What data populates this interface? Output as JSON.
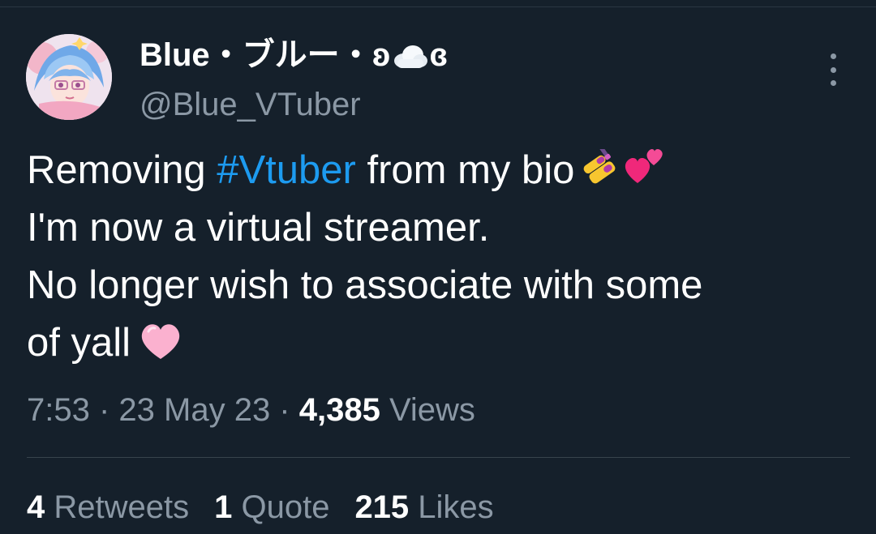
{
  "author": {
    "display_name_prefix": "Blue・ブルー・ʚ",
    "display_name_suffix": "ɞ",
    "handle": "@Blue_VTuber"
  },
  "tweet": {
    "line1_before": "Removing ",
    "hashtag": "#Vtuber",
    "line1_after": " from my bio",
    "line2": "I'm now a virtual streamer.",
    "line3": "No longer wish to associate with some",
    "line4": "of yall"
  },
  "meta": {
    "time": "7:53",
    "sep1": " · ",
    "date": "23 May 23",
    "sep2": " · ",
    "views_count": "4,385",
    "views_label": " Views"
  },
  "stats": {
    "retweets_count": "4",
    "retweets_label": " Retweets",
    "quotes_count": "1",
    "quotes_label": " Quote",
    "likes_count": "215",
    "likes_label": " Likes"
  },
  "icons": {
    "more": "more-vertical-icon",
    "cloud": "cloud-emoji",
    "nail_polish": "nail-polish-emoji",
    "two_hearts": "two-hearts-emoji",
    "pink_heart": "pink-heart-emoji"
  },
  "colors": {
    "background": "#15202b",
    "text": "#ffffff",
    "secondary": "#8b98a5",
    "link": "#1d9bf0",
    "divider": "#38444d"
  }
}
